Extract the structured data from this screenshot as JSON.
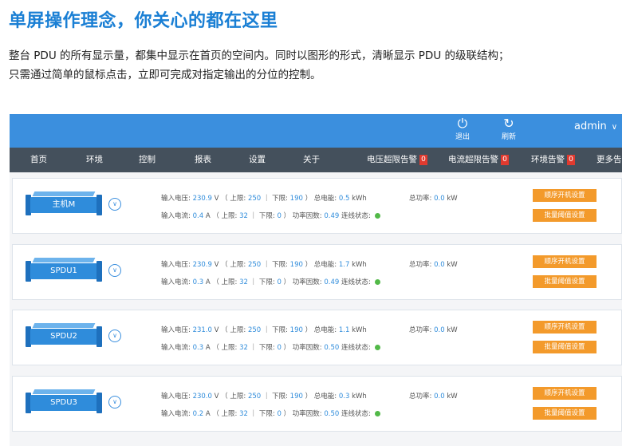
{
  "heading": "单屏操作理念，你关心的都在这里",
  "description": [
    "整台 PDU 的所有显示量，都集中显示在首页的空间内。同时以图形的形式，清晰显示 PDU 的级联结构；",
    "只需通过简单的鼠标点击，立即可完成对指定输出的分位的控制。"
  ],
  "topbar": {
    "logout": {
      "icon": "power-icon",
      "label": "退出"
    },
    "refresh": {
      "icon": "refresh-icon",
      "label": "刷新"
    },
    "user": "admin"
  },
  "nav": [
    {
      "label": "首页"
    },
    {
      "label": "环境"
    },
    {
      "label": "控制"
    },
    {
      "label": "报表"
    },
    {
      "label": "设置"
    },
    {
      "label": "关于"
    },
    {
      "label": "电压超限告警",
      "badge": "0"
    },
    {
      "label": "电流超限告警",
      "badge": "0"
    },
    {
      "label": "环境告警",
      "badge": "0"
    },
    {
      "label": "更多告警"
    }
  ],
  "labels": {
    "voltage": "输入电压:",
    "current": "输入电流:",
    "upper": "上限:",
    "lower": "下限:",
    "energy": "总电能:",
    "pf": "功率因数:",
    "link": "连线状态:",
    "power": "总功率:",
    "v_unit": "V",
    "a_unit": "A",
    "kwh_unit": "kWh",
    "kw_unit": "kW",
    "btn_sequence": "顺序开机设置",
    "btn_threshold": "批量阈值设置"
  },
  "devices": [
    {
      "name": "主机M",
      "voltage": "230.9",
      "v_upper": "250",
      "v_lower": "190",
      "energy": "0.5",
      "current": "0.4",
      "a_upper": "32",
      "a_lower": "0",
      "pf": "0.49",
      "power": "0.0"
    },
    {
      "name": "SPDU1",
      "voltage": "230.9",
      "v_upper": "250",
      "v_lower": "190",
      "energy": "1.7",
      "current": "0.3",
      "a_upper": "32",
      "a_lower": "0",
      "pf": "0.49",
      "power": "0.0"
    },
    {
      "name": "SPDU2",
      "voltage": "231.0",
      "v_upper": "250",
      "v_lower": "190",
      "energy": "1.1",
      "current": "0.3",
      "a_upper": "32",
      "a_lower": "0",
      "pf": "0.50",
      "power": "0.0"
    },
    {
      "name": "SPDU3",
      "voltage": "230.0",
      "v_upper": "250",
      "v_lower": "190",
      "energy": "0.3",
      "current": "0.2",
      "a_upper": "32",
      "a_lower": "0",
      "pf": "0.50",
      "power": "0.0"
    }
  ],
  "colors": {
    "heading": "#1a7fd4",
    "topbar": "#3b8fde",
    "navbar": "#44505c",
    "badge": "#e03a2f",
    "button": "#f39a2b",
    "link_ok": "#52b948"
  }
}
